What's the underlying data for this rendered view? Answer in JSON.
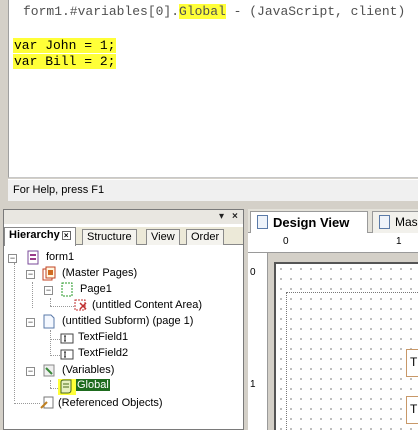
{
  "editor": {
    "title_prefix": "form1.#variables[0].",
    "title_highlight": "Global",
    "title_suffix": " - (JavaScript, client)",
    "code_lines": [
      "var John = 1;",
      "var Bill = 2;"
    ]
  },
  "status": {
    "help_text": "For Help, press F1"
  },
  "hierarchy": {
    "header_controls": {
      "menu": "▾",
      "close": "×"
    },
    "tabs": [
      {
        "label": "Hierarchy",
        "active": true
      },
      {
        "label": "Structure",
        "active": false
      },
      {
        "label": "View",
        "active": false
      },
      {
        "label": "Order",
        "active": false
      }
    ],
    "tree": {
      "root": "form1",
      "master_pages": "(Master Pages)",
      "page1": "Page1",
      "content_area": "(untitled Content Area)",
      "subform": "(untitled Subform) (page 1)",
      "textfield1": "TextField1",
      "textfield2": "TextField2",
      "variables": "(Variables)",
      "global": "Global",
      "referenced": "(Referenced Objects)"
    }
  },
  "design": {
    "tabs": [
      {
        "label": "Design View",
        "active": true
      },
      {
        "label": "Mas",
        "active": false
      }
    ],
    "ruler_top": [
      "0",
      "1"
    ],
    "ruler_left": [
      "0",
      "1"
    ],
    "field_labels": [
      "T",
      "T"
    ]
  },
  "colors": {
    "highlight": "#ffff38",
    "selection": "#1e6b1e"
  }
}
